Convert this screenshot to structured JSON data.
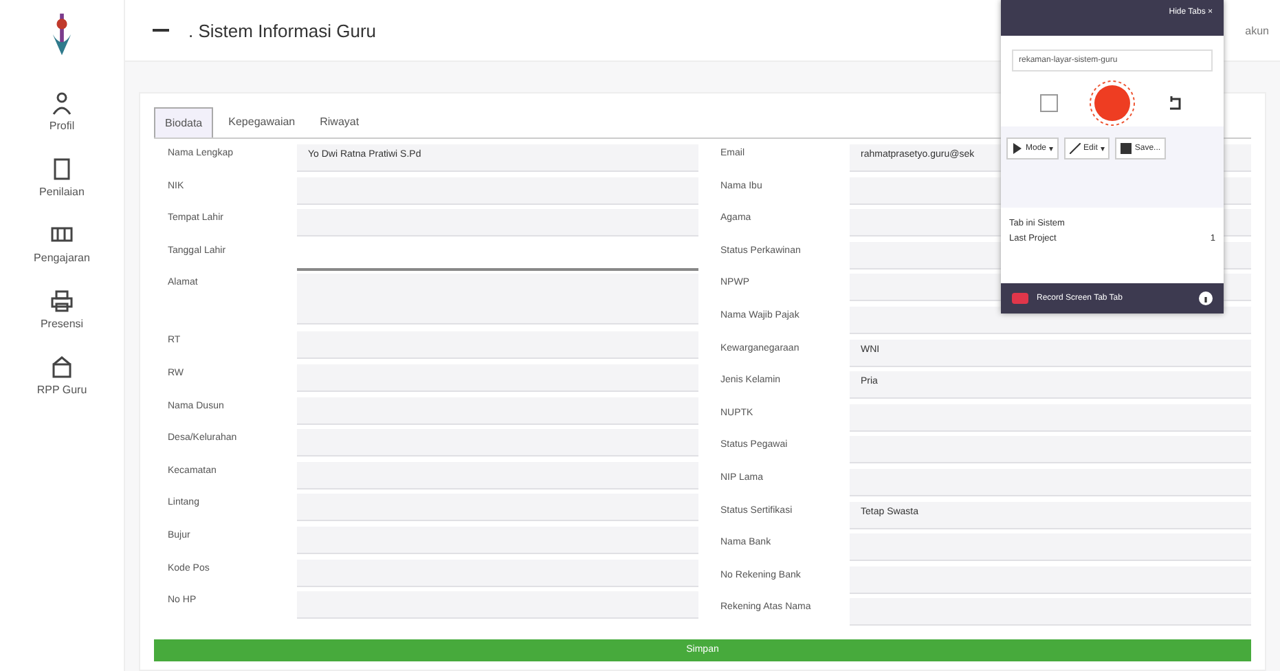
{
  "header": {
    "title": ". Sistem Informasi Guru",
    "user": "akun"
  },
  "sidebar": {
    "items": [
      {
        "label": "Profil"
      },
      {
        "label": "Penilaian"
      },
      {
        "label": "Pengajaran"
      },
      {
        "label": "Presensi"
      },
      {
        "label": "RPP Guru"
      }
    ]
  },
  "tabs": [
    {
      "label": "Biodata",
      "selected": true
    },
    {
      "label": "Kepegawaian",
      "selected": false
    },
    {
      "label": "Riwayat",
      "selected": false
    }
  ],
  "form_left": [
    {
      "label": "Nama Lengkap",
      "value": "Yo Dwi Ratna Pratiwi S.Pd"
    },
    {
      "label": "NIK"
    },
    {
      "label": "Tempat Lahir"
    },
    {
      "label": "Tanggal Lahir",
      "focused": true
    },
    {
      "label": "Alamat",
      "kind": "textarea"
    },
    {
      "label": "RT"
    },
    {
      "label": "RW"
    },
    {
      "label": "Nama Dusun"
    },
    {
      "label": "Desa/Kelurahan"
    },
    {
      "label": "Kecamatan"
    },
    {
      "label": "Lintang"
    },
    {
      "label": "Bujur"
    },
    {
      "label": "Kode Pos"
    },
    {
      "label": "No HP"
    }
  ],
  "form_right": [
    {
      "label": "Email",
      "value": "rahmatprasetyo.guru@sek"
    },
    {
      "label": "Nama Ibu"
    },
    {
      "label": "Agama"
    },
    {
      "label": "Status Perkawinan"
    },
    {
      "label": "NPWP"
    },
    {
      "label": "Nama Wajib Pajak"
    },
    {
      "label": "Kewarganegaraan",
      "value": "WNI"
    },
    {
      "label": "Jenis Kelamin",
      "value": "Pria"
    },
    {
      "label": "NUPTK"
    },
    {
      "label": "Status Pegawai"
    },
    {
      "label": "NIP Lama"
    },
    {
      "label": "Status Sertifikasi",
      "value": "Tetap Swasta"
    },
    {
      "label": "Nama Bank"
    },
    {
      "label": "No Rekening Bank"
    },
    {
      "label": "Rekening Atas Nama"
    }
  ],
  "submit": "Simpan",
  "recorder": {
    "header": "Hide Tabs ×",
    "field_value": "rekaman-layar-sistem-guru",
    "toolbar": [
      {
        "label": "Mode",
        "caret": "▾"
      },
      {
        "label": "Edit",
        "caret": "▾"
      },
      {
        "label": "Save..."
      }
    ],
    "list": [
      {
        "label": "Tab ini Sistem"
      },
      {
        "label": "Last Project",
        "count": "1"
      }
    ],
    "footer": "Record Screen Tab Tab"
  }
}
